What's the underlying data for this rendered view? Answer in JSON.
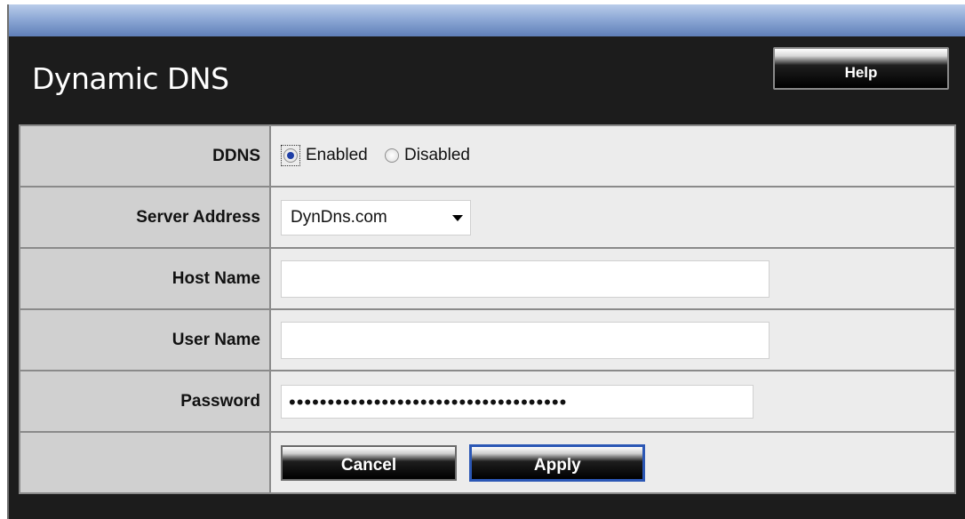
{
  "page": {
    "title": "Dynamic DNS",
    "help_label": "Help"
  },
  "form": {
    "ddns": {
      "label": "DDNS",
      "options": [
        "Enabled",
        "Disabled"
      ],
      "selected": "Enabled"
    },
    "server_address": {
      "label": "Server Address",
      "value": "DynDns.com"
    },
    "host_name": {
      "label": "Host Name",
      "value": ""
    },
    "user_name": {
      "label": "User Name",
      "value": ""
    },
    "password": {
      "label": "Password",
      "value": "••••••••••••••••••••••••••••••••••••"
    }
  },
  "actions": {
    "cancel_label": "Cancel",
    "apply_label": "Apply"
  },
  "colors": {
    "panel_bg": "#1c1c1c",
    "header_bar": "#8ea9d6",
    "label_bg": "#d0d0d0",
    "value_bg": "#ececec"
  }
}
